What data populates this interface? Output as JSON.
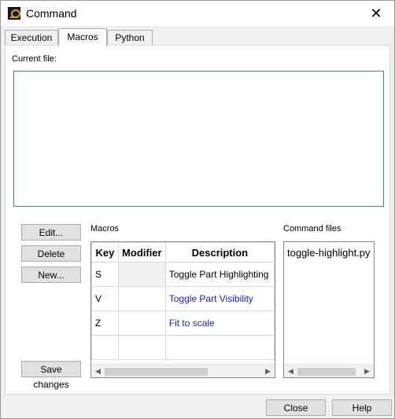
{
  "window": {
    "title": "Command",
    "close_glyph": "✕"
  },
  "tabs": [
    {
      "label": "Execution",
      "active": false
    },
    {
      "label": "Macros",
      "active": true
    },
    {
      "label": "Python",
      "active": false
    }
  ],
  "current_file": {
    "label": "Current file:",
    "value": ""
  },
  "buttons": {
    "edit": "Edit...",
    "delete": "Delete",
    "new": "New...",
    "save_changes": "Save changes"
  },
  "macros": {
    "label": "Macros",
    "columns": [
      "Key",
      "Modifier",
      "Description"
    ],
    "rows": [
      {
        "key": "S",
        "modifier": "",
        "description": "Toggle Part Highlighting"
      },
      {
        "key": "V",
        "modifier": "",
        "description": "Toggle Part Visibility"
      },
      {
        "key": "Z",
        "modifier": "",
        "description": "Fit to scale"
      },
      {
        "key": "",
        "modifier": "",
        "description": ""
      }
    ],
    "link_color": "#1a1ad0"
  },
  "command_files": {
    "label": "Command files",
    "items": [
      "toggle-highlight.py"
    ]
  },
  "footer": {
    "close": "Close",
    "help": "Help"
  },
  "icons": {
    "scroll_left": "◀",
    "scroll_right": "▶"
  }
}
